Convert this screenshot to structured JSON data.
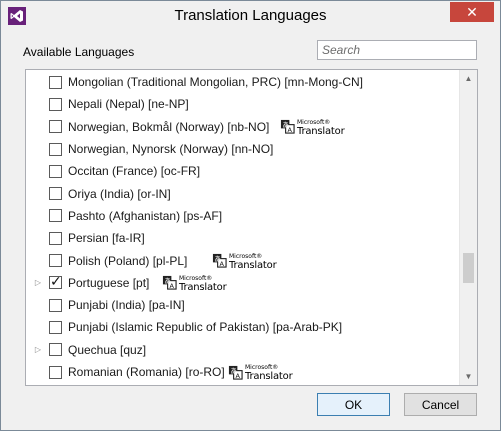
{
  "window": {
    "title": "Translation Languages",
    "close_glyph": "✕"
  },
  "section_label": "Available Languages",
  "search": {
    "placeholder": "Search",
    "value": ""
  },
  "ms_translator": {
    "top": "Microsoft®",
    "bottom": "Translator"
  },
  "languages": [
    {
      "label": "Mongolian (Traditional Mongolian, PRC) [mn-Mong-CN]",
      "checked": false,
      "expander": false,
      "translator": false
    },
    {
      "label": "Nepali (Nepal) [ne-NP]",
      "checked": false,
      "expander": false,
      "translator": false
    },
    {
      "label": "Norwegian, Bokmål (Norway) [nb-NO]",
      "checked": false,
      "expander": false,
      "translator": true
    },
    {
      "label": "Norwegian, Nynorsk (Norway) [nn-NO]",
      "checked": false,
      "expander": false,
      "translator": false
    },
    {
      "label": "Occitan (France) [oc-FR]",
      "checked": false,
      "expander": false,
      "translator": false
    },
    {
      "label": "Oriya (India) [or-IN]",
      "checked": false,
      "expander": false,
      "translator": false
    },
    {
      "label": "Pashto (Afghanistan) [ps-AF]",
      "checked": false,
      "expander": false,
      "translator": false
    },
    {
      "label": "Persian [fa-IR]",
      "checked": false,
      "expander": false,
      "translator": false
    },
    {
      "label": "Polish (Poland) [pl-PL]",
      "checked": false,
      "expander": false,
      "translator": true
    },
    {
      "label": "Portuguese [pt]",
      "checked": true,
      "expander": true,
      "translator": true
    },
    {
      "label": "Punjabi (India) [pa-IN]",
      "checked": false,
      "expander": false,
      "translator": false
    },
    {
      "label": "Punjabi (Islamic Republic of Pakistan) [pa-Arab-PK]",
      "checked": false,
      "expander": false,
      "translator": false
    },
    {
      "label": "Quechua [quz]",
      "checked": false,
      "expander": true,
      "translator": false
    },
    {
      "label": "Romanian (Romania) [ro-RO]",
      "checked": false,
      "expander": false,
      "translator": true
    }
  ],
  "buttons": {
    "ok": "OK",
    "cancel": "Cancel"
  },
  "icons": {
    "app": "visual-studio-icon",
    "expander": "triangle-right-icon",
    "check": "checkmark-icon",
    "scroll_up": "chevron-up-icon",
    "scroll_down": "chevron-down-icon",
    "translator_logo": "microsoft-translator-logo"
  },
  "colors": {
    "app_icon": "#68217a",
    "close_button": "#c7463c",
    "default_button_border": "#3c7fb1"
  }
}
